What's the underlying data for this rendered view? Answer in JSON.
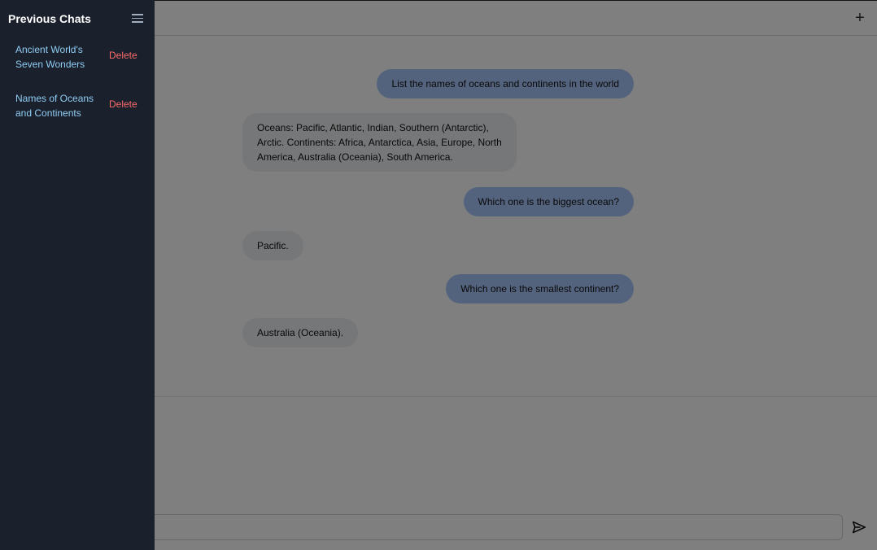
{
  "sidebar": {
    "title": "Previous Chats",
    "menu_icon": "hamburger-menu-icon",
    "chats": [
      {
        "title": "Ancient World's Seven Wonders",
        "delete_label": "Delete"
      },
      {
        "title": "Names of Oceans and Continents",
        "delete_label": "Delete"
      }
    ]
  },
  "header": {
    "new_chat_icon": "plus-icon",
    "new_chat_glyph": "+"
  },
  "messages": [
    {
      "role": "user",
      "text": "List the names of oceans and continents in the world"
    },
    {
      "role": "assistant",
      "text": "Oceans: Pacific, Atlantic, Indian, Southern (Antarctic), Arctic. Continents: Africa, Antarctica, Asia, Europe, North America, Australia (Oceania), South America."
    },
    {
      "role": "user",
      "text": "Which one is the biggest ocean?"
    },
    {
      "role": "assistant",
      "text": "Pacific."
    },
    {
      "role": "user",
      "text": "Which one is the smallest continent?"
    },
    {
      "role": "assistant",
      "text": "Australia (Oceania)."
    }
  ],
  "composer": {
    "value": "",
    "placeholder": "",
    "send_icon": "send-icon"
  },
  "colors": {
    "sidebar_bg": "#1a202c",
    "chat_link": "#90cdf4",
    "delete": "#fc6b6b",
    "user_bubble": "#a8c7fa",
    "assistant_bubble": "#eceef0"
  }
}
